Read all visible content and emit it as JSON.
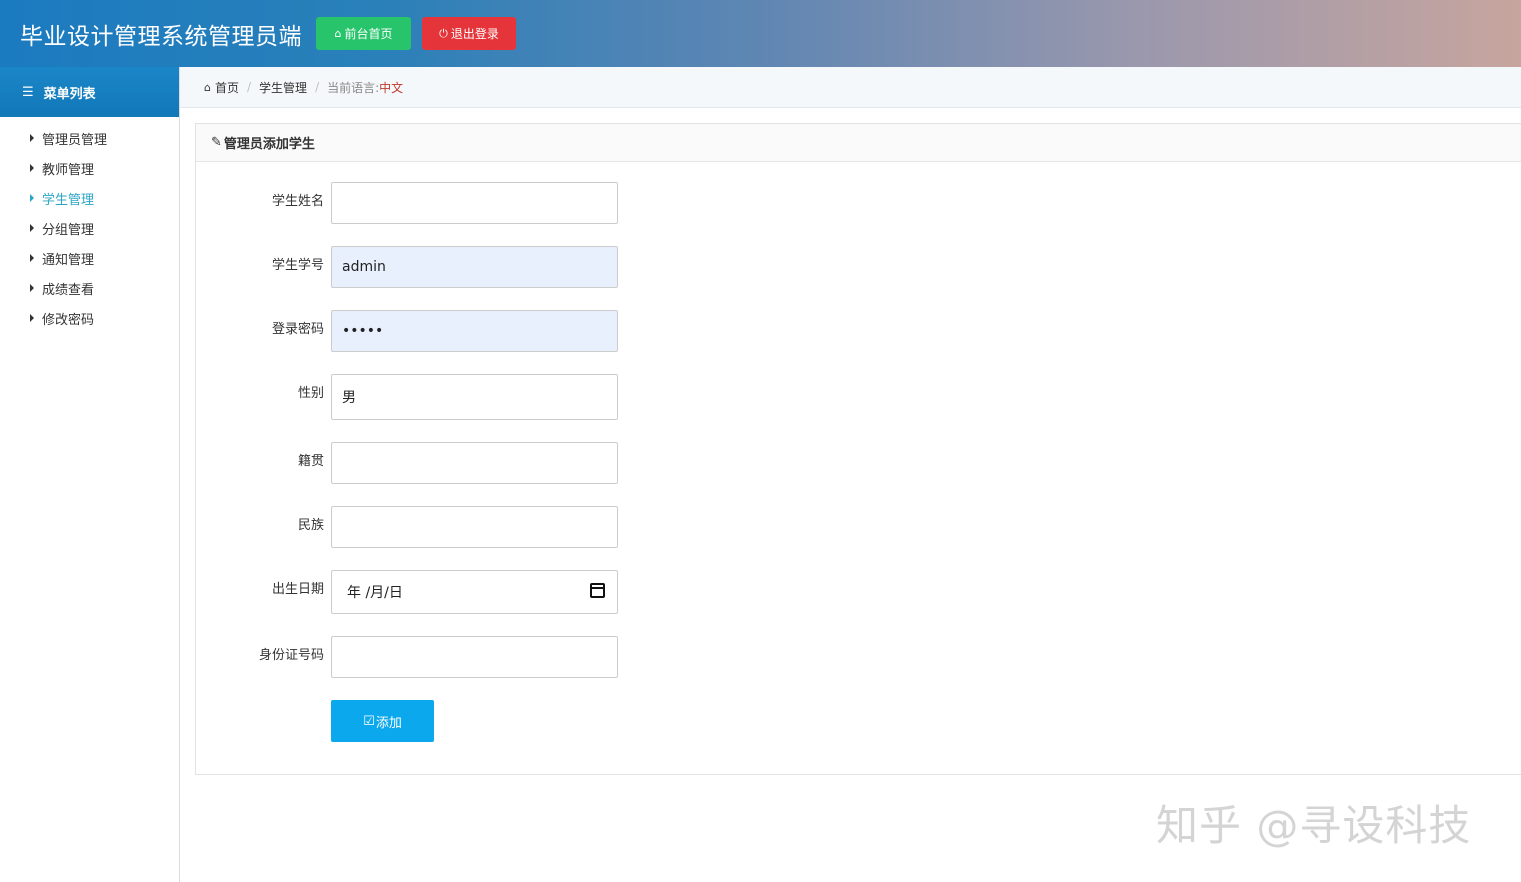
{
  "header": {
    "title": "毕业设计管理系统管理员端",
    "home_button": "前台首页",
    "logout_button": "退出登录"
  },
  "sidebar": {
    "heading": "菜单列表",
    "items": [
      {
        "label": "管理员管理"
      },
      {
        "label": "教师管理"
      },
      {
        "label": "学生管理",
        "active": true
      },
      {
        "label": "分组管理"
      },
      {
        "label": "通知管理"
      },
      {
        "label": "成绩查看"
      },
      {
        "label": "修改密码"
      }
    ]
  },
  "breadcrumb": {
    "home": "首页",
    "section": "学生管理",
    "language_label": "当前语言:",
    "language_value": "中文"
  },
  "form": {
    "title": "管理员添加学生",
    "fields": [
      {
        "label": "学生姓名",
        "value": ""
      },
      {
        "label": "学生学号",
        "value": "admin"
      },
      {
        "label": "登录密码",
        "value": "•••••"
      },
      {
        "label": "性别",
        "value": "男"
      },
      {
        "label": "籍贯",
        "value": ""
      },
      {
        "label": "民族",
        "value": ""
      },
      {
        "label": "出生日期",
        "value": "年 /月/日"
      },
      {
        "label": "身份证号码",
        "value": ""
      }
    ],
    "submit": "添加"
  },
  "watermark": "知乎 @寻设科技",
  "colors": {
    "accent": "#2aa6c7",
    "home_button": "#27c46b",
    "logout_button": "#e5353a",
    "submit_button": "#0ba8ee"
  }
}
